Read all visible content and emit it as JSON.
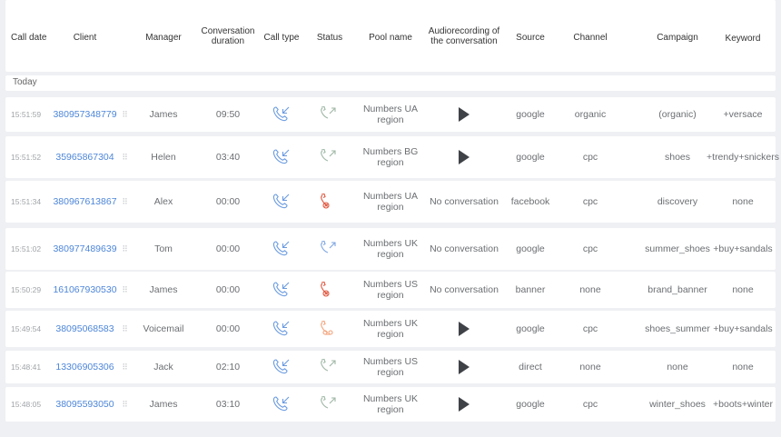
{
  "columns": {
    "call_date": "Call date",
    "client": "Client",
    "manager": "Manager",
    "duration": "Conversation duration",
    "call_type": "Call type",
    "status": "Status",
    "pool": "Pool name",
    "audio": "Audiorecording of the conversation",
    "source": "Source",
    "channel": "Channel",
    "campaign": "Campaign",
    "keyword": "Keyword"
  },
  "group_label": "Today",
  "drag_glyph": "⠿",
  "colors": {
    "link": "#4d86d9",
    "incoming_icon": "#6a9be0",
    "status_answered": "#9fb7a6",
    "status_missed": "#e0573f",
    "status_voicemail": "#f3a37a",
    "status_blue": "#7ea6e3"
  },
  "rows": [
    {
      "time": "15:51:59",
      "client": "380957348779",
      "manager": "James",
      "duration": "09:50",
      "call_type_icon": "incoming-call-icon",
      "status_icon": "answered-call-icon",
      "pool": "Numbers UA region",
      "audio": "play",
      "source": "google",
      "channel": "organic",
      "campaign": "(organic)",
      "keyword": "+versace"
    },
    {
      "time": "15:51:52",
      "client": "35965867304",
      "manager": "Helen",
      "duration": "03:40",
      "call_type_icon": "incoming-call-icon",
      "status_icon": "answered-call-icon",
      "pool": "Numbers BG region",
      "audio": "play",
      "source": "google",
      "channel": "cpc",
      "campaign": "shoes",
      "keyword": "+trendy+snickers"
    },
    {
      "time": "15:51:34",
      "client": "380967613867",
      "manager": "Alex",
      "duration": "00:00",
      "call_type_icon": "incoming-call-icon",
      "status_icon": "missed-call-icon",
      "pool": "Numbers UA region",
      "audio": "No conversation",
      "source": "facebook",
      "channel": "cpc",
      "campaign": "discovery",
      "keyword": "none"
    },
    {
      "time": "15:51:02",
      "client": "380977489639",
      "manager": "Tom",
      "duration": "00:00",
      "call_type_icon": "incoming-call-icon",
      "status_icon": "unanswered-call-icon",
      "pool": "Numbers UK region",
      "audio": "No conversation",
      "source": "google",
      "channel": "cpc",
      "campaign": "summer_shoes",
      "keyword": "+buy+sandals"
    },
    {
      "time": "15:50:29",
      "client": "161067930530",
      "manager": "James",
      "duration": "00:00",
      "call_type_icon": "incoming-call-icon",
      "status_icon": "missed-call-icon",
      "pool": "Numbers US region",
      "audio": "No conversation",
      "source": "banner",
      "channel": "none",
      "campaign": "brand_banner",
      "keyword": "none"
    },
    {
      "time": "15:49:54",
      "client": "38095068583",
      "manager": "Voicemail",
      "duration": "00:00",
      "call_type_icon": "incoming-call-icon",
      "status_icon": "voicemail-call-icon",
      "pool": "Numbers UK region",
      "audio": "play",
      "source": "google",
      "channel": "cpc",
      "campaign": "shoes_summer",
      "keyword": "+buy+sandals"
    },
    {
      "time": "15:48:41",
      "client": "13306905306",
      "manager": "Jack",
      "duration": "02:10",
      "call_type_icon": "incoming-call-icon",
      "status_icon": "answered-call-icon",
      "pool": "Numbers US region",
      "audio": "play",
      "source": "direct",
      "channel": "none",
      "campaign": "none",
      "keyword": "none"
    },
    {
      "time": "15:48:05",
      "client": "38095593050",
      "manager": "James",
      "duration": "03:10",
      "call_type_icon": "incoming-call-icon",
      "status_icon": "answered-call-icon",
      "pool": "Numbers UK region",
      "audio": "play",
      "source": "google",
      "channel": "cpc",
      "campaign": "winter_shoes",
      "keyword": "+boots+winter"
    }
  ]
}
